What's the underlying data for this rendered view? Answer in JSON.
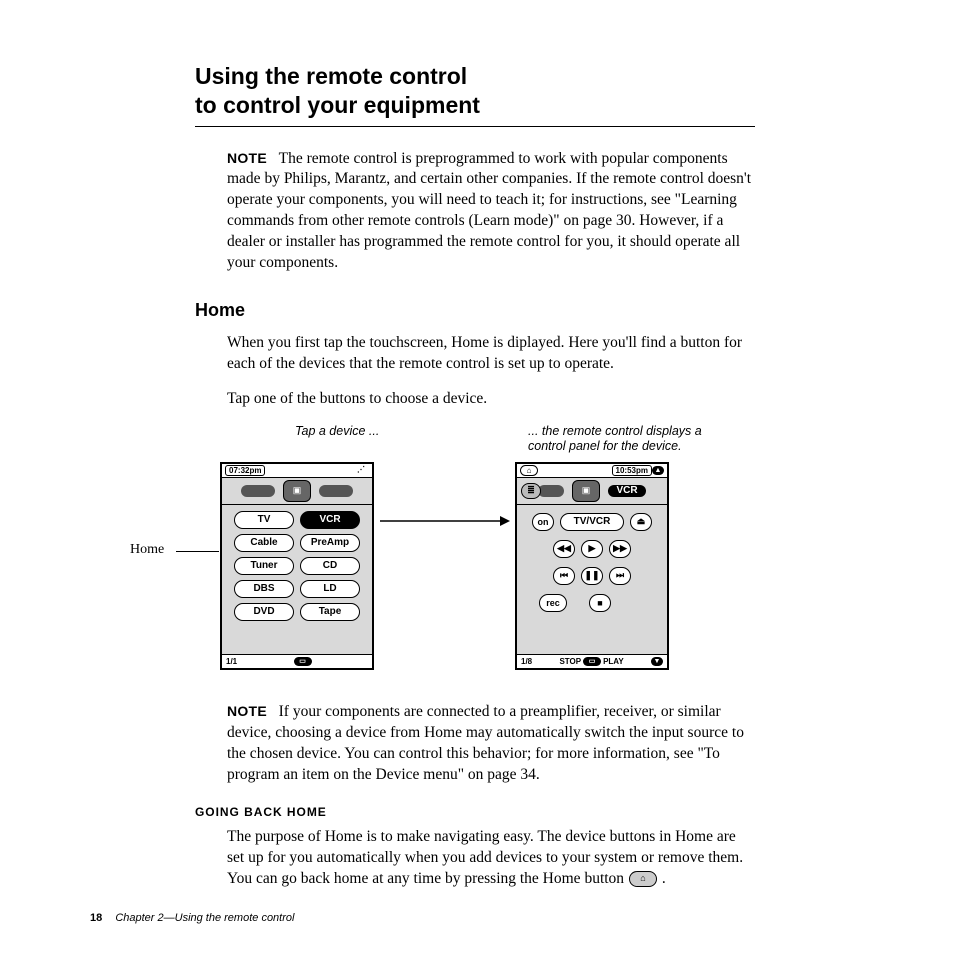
{
  "title_line1": "Using the remote control",
  "title_line2": "to control your equipment",
  "note_label": "NOTE",
  "note1_text": "The remote control is preprogrammed to work with popular components made by Philips, Marantz, and certain other companies. If the remote control doesn't operate your components, you will need to teach it; for instructions, see \"Learning commands from other remote controls (Learn mode)\" on page 30. However, if a dealer or installer has programmed the remote control for you, it should operate all your components.",
  "section_home": "Home",
  "home_p1": "When you first tap the touchscreen, Home is diplayed. Here you'll find a button for each of the devices that the remote control is set up to operate.",
  "home_p2": "Tap one of the buttons to choose a device.",
  "caption_left": "Tap a device ...",
  "caption_right": "... the remote control displays a control panel for the device.",
  "home_side_label": "Home",
  "left_screen": {
    "time": "07:32pm",
    "page": "1/1",
    "devices": [
      [
        "TV",
        "VCR"
      ],
      [
        "Cable",
        "PreAmp"
      ],
      [
        "Tuner",
        "CD"
      ],
      [
        "DBS",
        "LD"
      ],
      [
        "DVD",
        "Tape"
      ]
    ],
    "selected": "VCR"
  },
  "right_screen": {
    "time": "10:53pm",
    "title": "VCR",
    "page": "1/8",
    "bottom_l": "STOP",
    "bottom_r": "PLAY",
    "row1": [
      "on",
      "TV/VCR",
      "⏏"
    ],
    "row2": [
      "◀◀",
      "▶",
      "▶▶"
    ],
    "row3": [
      "⏮",
      "❚❚",
      "⏭"
    ],
    "row4": [
      "rec",
      "■"
    ]
  },
  "note2_text": "If your components are connected to a preamplifier, receiver, or similar device, choosing a device from Home may automatically switch the input source to the chosen device. You can control this behavior; for more information, see \"To program an item on the Device menu\" on page 34.",
  "subsection_going_back": "GOING BACK HOME",
  "going_back_p1a": "The purpose of Home is to make navigating easy. The device buttons in Home are set up for you automatically when you add devices to your system or remove them. You can go back home at any time by pressing the Home button ",
  "going_back_p1b": " .",
  "home_icon_glyph": "⌂",
  "footer_page": "18",
  "footer_chapter": "Chapter 2—Using the remote control"
}
